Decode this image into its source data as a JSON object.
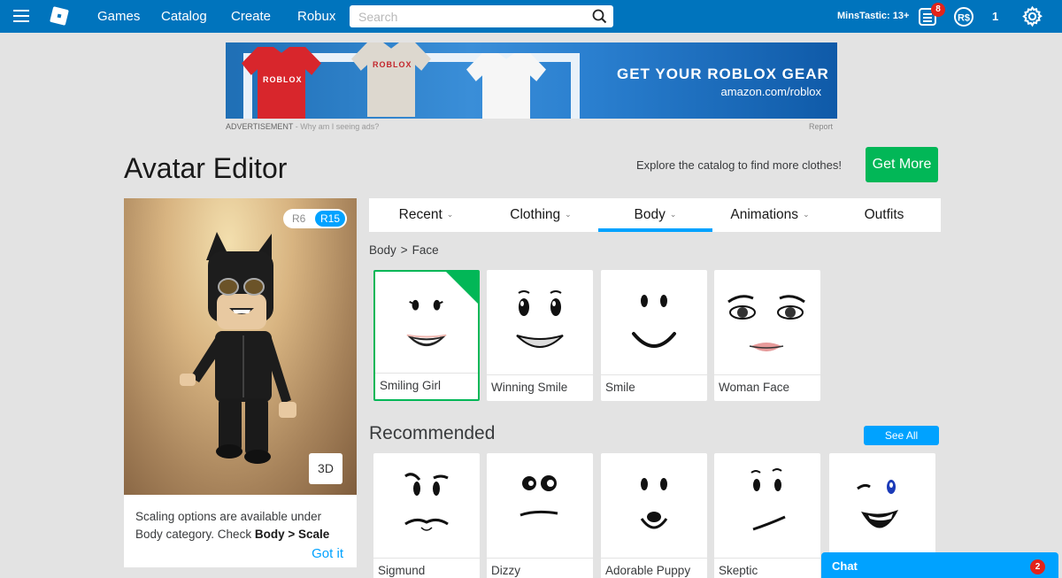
{
  "topnav": {
    "links": [
      "Games",
      "Catalog",
      "Create",
      "Robux"
    ],
    "search_placeholder": "Search",
    "search_value": "",
    "username": "MinsTastic: 13+",
    "messages_badge": "8",
    "robux_count": "1"
  },
  "ad": {
    "headline": "GET YOUR ROBLOX GEAR",
    "url": "amazon.com/roblox",
    "shirt_text": "ROBLOX",
    "label": "ADVERTISEMENT",
    "why": "- Why am I seeing ads?",
    "report": "Report"
  },
  "header": {
    "title": "Avatar Editor",
    "explore_text": "Explore the catalog to find more clothes!",
    "get_more_label": "Get More"
  },
  "avatar": {
    "rig_r6": "R6",
    "rig_r15": "R15",
    "rig_selected": "R15",
    "view_toggle": "3D",
    "tip_text": "Scaling options are available under Body category. Check ",
    "tip_bold_1": "Body",
    "tip_sep": ">",
    "tip_bold_2": "Scale",
    "got_it": "Got it"
  },
  "tabs": [
    {
      "label": "Recent",
      "dropdown": true,
      "active": false
    },
    {
      "label": "Clothing",
      "dropdown": true,
      "active": false
    },
    {
      "label": "Body",
      "dropdown": true,
      "active": true
    },
    {
      "label": "Animations",
      "dropdown": true,
      "active": false
    },
    {
      "label": "Outfits",
      "dropdown": false,
      "active": false
    }
  ],
  "breadcrumb": {
    "parent": "Body",
    "separator": ">",
    "current": "Face"
  },
  "items": [
    {
      "name": "Smiling Girl",
      "selected": true
    },
    {
      "name": "Winning Smile",
      "selected": false
    },
    {
      "name": "Smile",
      "selected": false
    },
    {
      "name": "Woman Face",
      "selected": false
    }
  ],
  "recommended": {
    "title": "Recommended",
    "see_all": "See All",
    "items": [
      "Sigmund",
      "Dizzy",
      "Adorable Puppy",
      "Skeptic",
      ""
    ]
  },
  "chat": {
    "label": "Chat",
    "badge": "2"
  },
  "colors": {
    "nav_blue": "#0074bd",
    "accent_blue": "#00a2ff",
    "green": "#02b757",
    "badge_red": "#e2231a",
    "page_bg": "#e3e3e3"
  }
}
